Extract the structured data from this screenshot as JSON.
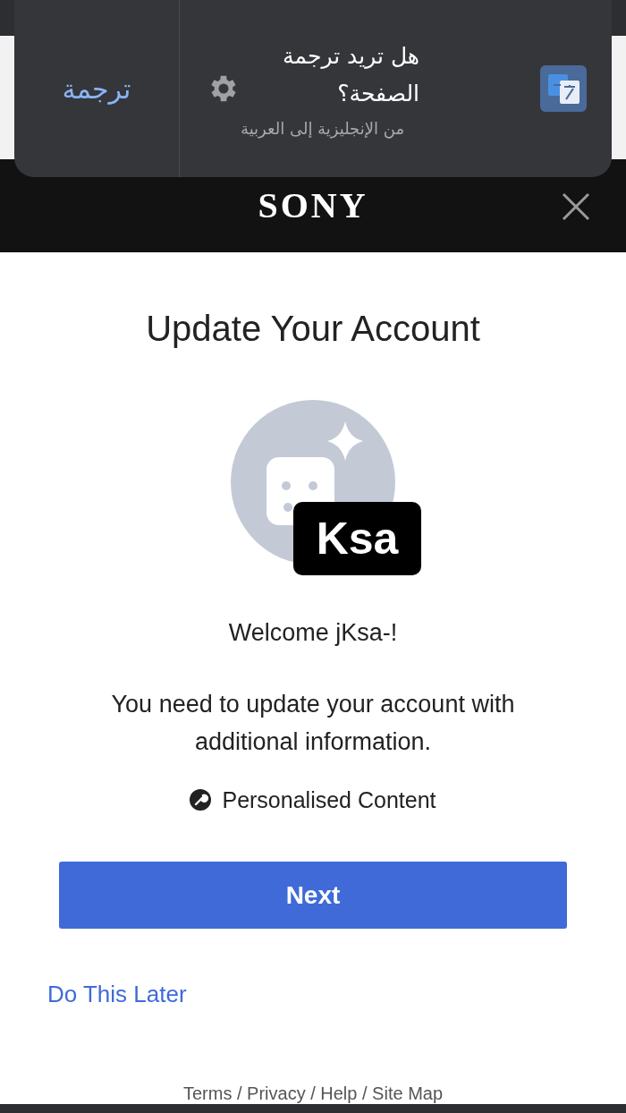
{
  "translate_bar": {
    "title": "هل تريد ترجمة الصفحة؟",
    "subtitle": "من الإنجليزية إلى العربية",
    "action": "ترجمة"
  },
  "header": {
    "logo": "SONY"
  },
  "title": "Update Your Account",
  "avatar_label": "Ksa",
  "welcome": "Welcome jKsa-!",
  "message": "You need to update your account with additional information.",
  "feature": "Personalised Content",
  "primary_button": "Next",
  "secondary_link": "Do This Later",
  "footer": "Terms / Privacy / Help / Site Map"
}
